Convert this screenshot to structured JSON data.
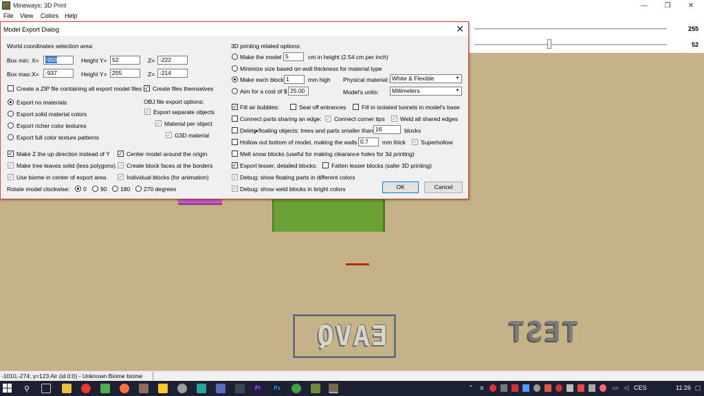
{
  "window": {
    "title": "Mineways: 3D Print"
  },
  "menu": [
    "File",
    "View",
    "Colors",
    "Help"
  ],
  "sliders": {
    "top_value": "255",
    "bottom_value": "52"
  },
  "status_bar": {
    "text": "-1010,-274; y=123 Air (id 0:0) - Unknown Biome biome"
  },
  "map_text": {
    "sign": "EAVQ",
    "test": "TEST"
  },
  "taskbar": {
    "lang": "CES",
    "time": "11:26"
  },
  "dialog": {
    "title": "Model Export Dialog",
    "close_glyph": "✕",
    "world_section": "World coordinates selection area:",
    "box_min": {
      "label": "Box min:",
      "x_label": "X=",
      "x": "-950",
      "height_label": "Height Y=",
      "y": "52",
      "z_label": "Z=",
      "z": "-222"
    },
    "box_max": {
      "label": "Box max:",
      "x_label": "X=",
      "x": "-937",
      "height_label": "Height Y=",
      "y": "255",
      "z_label": "Z=",
      "z": "-214"
    },
    "zip_label": "Create a ZIP file containing all export model files",
    "create_files_label": "Create files themselves",
    "materials": [
      "Export no materials",
      "Export solid material colors",
      "Export richer color textures",
      "Export full color texture patterns"
    ],
    "obj_section": "OBJ file export options:",
    "obj_separate": "Export separate objects",
    "obj_material": "Material per object",
    "obj_g3d": "G3D material",
    "opt_z_up": "Make Z the up direction instead of Y",
    "opt_center": "Center model around the origin",
    "opt_leaves": "Make tree leaves solid (less polygons)",
    "opt_faces": "Create block faces at the borders",
    "opt_biome": "Use biome in center of export area",
    "opt_individual": "Individual blocks (for animation)",
    "rotate_label": "Rotate model clockwise:",
    "rotate_options": [
      "0",
      "90",
      "180",
      "270 degrees"
    ],
    "print_section": "3D printing related options:",
    "make_model": "Make the model",
    "make_model_value": "5",
    "make_model_unit": "cm in height (2.54 cm per inch)",
    "minimize_label": "Minimize size based on wall thickness for material type",
    "make_each": "Make each block",
    "make_each_value": "1",
    "make_each_unit": "mm high",
    "aim_cost": "Aim for a cost of $",
    "aim_cost_value": "25.00",
    "physical_label": "Physical material:",
    "physical_value": "White & Flexible",
    "units_label": "Model's units:",
    "units_value": "Millimeters",
    "fill_air": "Fill air bubbles:",
    "seal_off": "Seal off entrances",
    "fill_isolated": "Fill in isolated tunnels in model's base",
    "connect_edge": "Connect parts sharing an edge:",
    "connect_corner": "Connect corner tips",
    "weld_edges": "Weld all shared edges",
    "delete_floating": "Delete floating objects: trees and parts smaller than",
    "delete_value": "16",
    "delete_unit": "blocks",
    "hollow_label": "Hollow out bottom of model, making the walls",
    "hollow_value": "0.7",
    "hollow_unit": "mm thick",
    "superhollow": "Superhollow",
    "melt_snow": "Melt snow blocks (useful for making clearance holes for 3d printing)",
    "export_lesser": "Export lesser, detailed blocks:",
    "fatten_lesser": "Fatten lesser blocks (safer 3D printing)",
    "debug_floating": "Debug: show floating parts in different colors",
    "debug_weld": "Debug: show weld blocks in bright colors",
    "ok_label": "OK",
    "cancel_label": "Cancel"
  }
}
